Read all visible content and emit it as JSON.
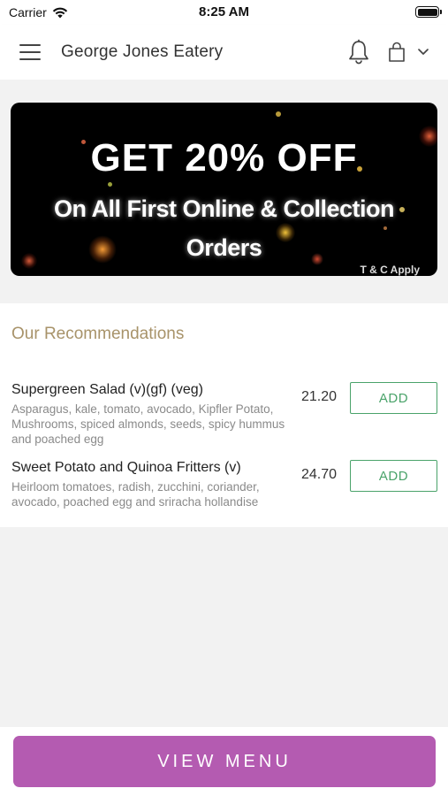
{
  "status_bar": {
    "carrier": "Carrier",
    "time": "8:25 AM",
    "icons": [
      "wifi-icon",
      "battery-icon"
    ]
  },
  "nav": {
    "title": "George Jones Eatery",
    "icons": [
      "menu-icon",
      "bell-icon",
      "shopping-bag-icon",
      "chevron-down-icon"
    ]
  },
  "banner": {
    "headline": "GET 20% OFF",
    "subline": "On All First Online & Collection Orders",
    "tc": "T & C Apply"
  },
  "recommendations": {
    "heading": "Our Recommendations",
    "items": [
      {
        "name": "Supergreen Salad (v)(gf) (veg)",
        "description": "Asparagus, kale, tomato, avocado, Kipfler Potato, Mushrooms, spiced almonds, seeds, spicy hummus and poached egg",
        "price": "21.20",
        "button": "ADD"
      },
      {
        "name": "Sweet Potato and Quinoa Fritters (v)",
        "description": "Heirloom tomatoes, radish, zucchini, coriander, avocado, poached egg and sriracha hollandise",
        "price": "24.70",
        "button": "ADD"
      }
    ]
  },
  "footer": {
    "button": "VIEW MENU"
  },
  "colors": {
    "accent_purple": "#b45bb1",
    "add_green": "#4aa36a",
    "heading_gold": "#a8936a"
  }
}
